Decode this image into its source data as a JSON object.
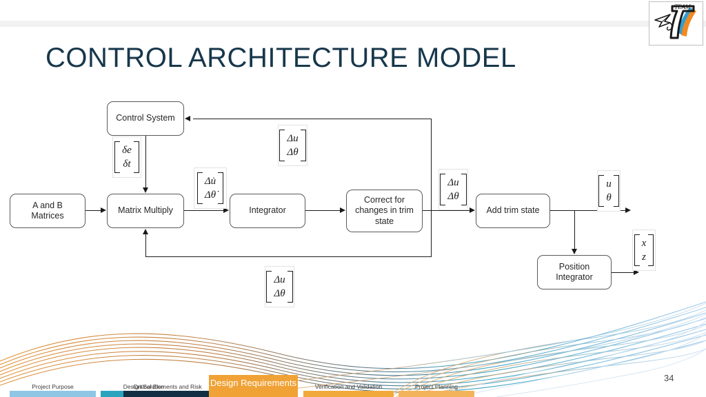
{
  "slide": {
    "title": "CONTROL ARCHITECTURE MODEL",
    "page_number": "34",
    "title_color": "#17374b"
  },
  "logo": {
    "name": "team-7-logo",
    "team_word": "TEAM",
    "number": "7",
    "accent_blue": "#2f9ed4",
    "accent_orange": "#ef8a22"
  },
  "diagram": {
    "blocks": [
      {
        "id": "a-and-b-matrices",
        "label": "A and B\nMatrices"
      },
      {
        "id": "control-system",
        "label": "Control System"
      },
      {
        "id": "matrix-multiply",
        "label": "Matrix Multiply"
      },
      {
        "id": "integrator",
        "label": "Integrator"
      },
      {
        "id": "correct-for-changes-in-trim-state",
        "label": "Correct for\nchanges in trim\nstate"
      },
      {
        "id": "add-trim-state",
        "label": "Add trim state"
      },
      {
        "id": "position-integrator",
        "label": "Position\nIntegrator"
      }
    ],
    "matrix_labels": [
      {
        "id": "control-output-signal",
        "rows": [
          "δe",
          "δt"
        ]
      },
      {
        "id": "state-derivatives",
        "rows": [
          "Δu̇",
          "Δθ̇"
        ]
      },
      {
        "id": "feedback-to-control-system",
        "rows": [
          "Δu",
          "Δθ"
        ]
      },
      {
        "id": "trim-correction-output",
        "rows": [
          "Δu",
          "Δθ"
        ]
      },
      {
        "id": "feedback-to-matrix-multiply",
        "rows": [
          "Δu",
          "Δθ"
        ]
      },
      {
        "id": "absolute-state-output",
        "rows": [
          "u",
          "θ"
        ]
      },
      {
        "id": "position-output",
        "rows": [
          "x",
          "z"
        ]
      }
    ]
  },
  "nav": {
    "tabs": [
      {
        "label": "Project Purpose",
        "color": "#8fc6e3",
        "active": false
      },
      {
        "label": "Design Solution",
        "color": "#2aa3bf",
        "active": false
      },
      {
        "label": "Critical Elements and Risk",
        "color": "#122f44",
        "active": false
      },
      {
        "label": "Design Requirements",
        "color": "#f0a236",
        "active": true
      },
      {
        "label": "Verification and Validation",
        "color": "#f2a93b",
        "active": false
      },
      {
        "label": "Project Planning",
        "color": "#f3b35a",
        "active": false
      }
    ]
  }
}
